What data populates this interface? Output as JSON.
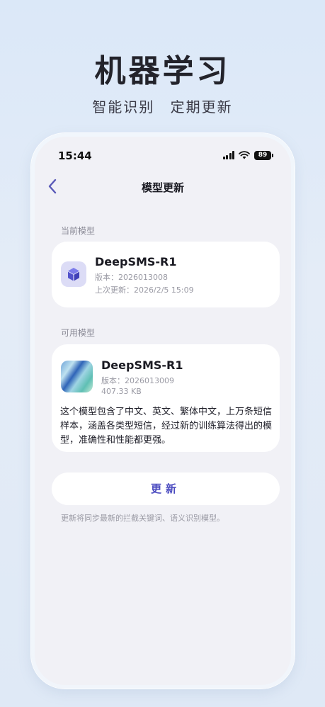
{
  "hero": {
    "title": "机器学习",
    "subtitle": "智能识别  定期更新"
  },
  "status_bar": {
    "time": "15:44",
    "battery": "89"
  },
  "nav": {
    "back_icon": "chevron-left-icon",
    "title": "模型更新"
  },
  "current_model": {
    "section_label": "当前模型",
    "icon": "cube-icon",
    "name": "DeepSMS-R1",
    "version": "版本：2026013008",
    "last_updated": "上次更新：2026/2/5 15:09"
  },
  "available_model": {
    "section_label": "可用模型",
    "name": "DeepSMS-R1",
    "version": "版本：2026013009",
    "size": "407.33 KB",
    "description": "这个模型包含了中文、英文、繁体中文，上万条短信样本，涵盖各类型短信，经过新的训练算法得出的模型，准确性和性能都更强。"
  },
  "update": {
    "button_label": "更新",
    "note": "更新将同步最新的拦截关键词、语义识别模型。"
  },
  "colors": {
    "accent": "#4c4cc0",
    "background": "#dbe8f8",
    "screen": "#f1f1f6"
  }
}
